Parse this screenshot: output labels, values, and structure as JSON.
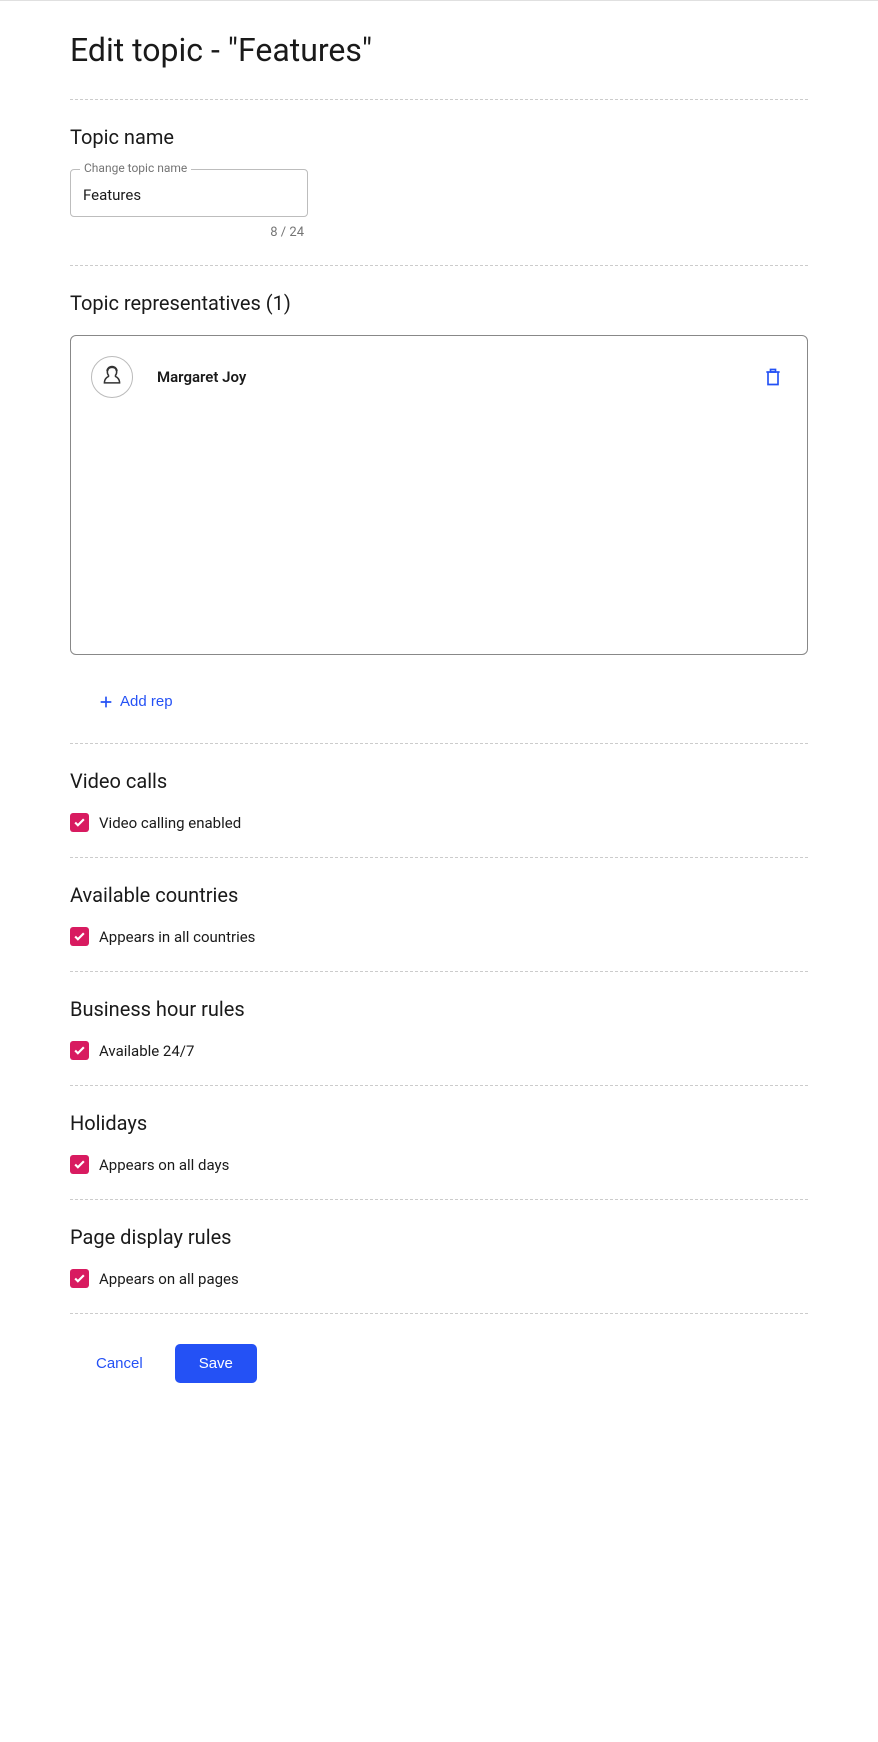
{
  "pageTitle": "Edit topic - \"Features\"",
  "topicName": {
    "sectionTitle": "Topic name",
    "fieldLabel": "Change topic name",
    "value": "Features",
    "counter": "8 / 24"
  },
  "representatives": {
    "sectionTitle": "Topic representatives (1)",
    "items": [
      {
        "name": "Margaret Joy"
      }
    ],
    "addLabel": "Add rep"
  },
  "videoCalls": {
    "sectionTitle": "Video calls",
    "checkboxLabel": "Video calling enabled",
    "checked": true
  },
  "availableCountries": {
    "sectionTitle": "Available countries",
    "checkboxLabel": "Appears in all countries",
    "checked": true
  },
  "businessHours": {
    "sectionTitle": "Business hour rules",
    "checkboxLabel": "Available 24/7",
    "checked": true
  },
  "holidays": {
    "sectionTitle": "Holidays",
    "checkboxLabel": "Appears on all days",
    "checked": true
  },
  "pageDisplay": {
    "sectionTitle": "Page display rules",
    "checkboxLabel": "Appears on all pages",
    "checked": true
  },
  "footer": {
    "cancel": "Cancel",
    "save": "Save"
  }
}
